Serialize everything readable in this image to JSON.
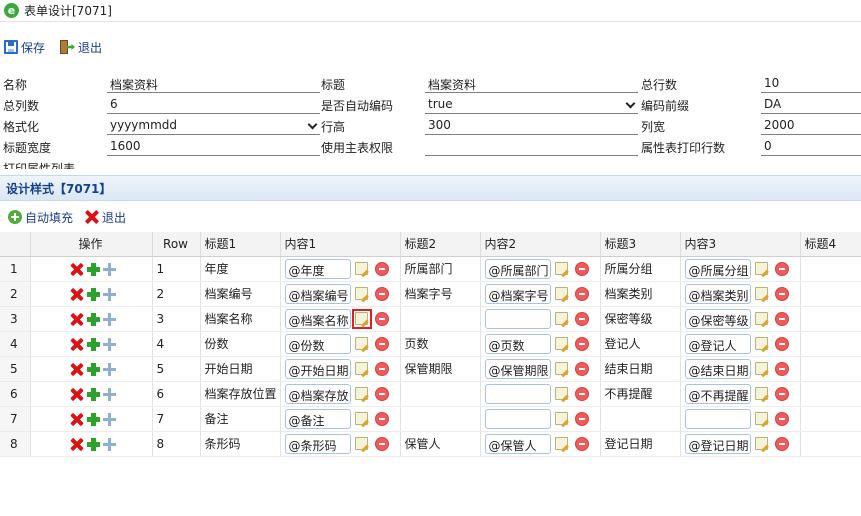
{
  "window": {
    "title": "表单设计[7071]",
    "icon": "app-logo-e"
  },
  "toolbar": {
    "save_label": "保存",
    "exit_label": "退出"
  },
  "form": {
    "rows": [
      [
        {
          "label": "名称",
          "value": "档案资料"
        },
        {
          "label": "标题",
          "value": "档案资料"
        },
        {
          "label": "总行数",
          "value": "10"
        }
      ],
      [
        {
          "label": "总列数",
          "value": "6"
        },
        {
          "label": "是否自动编码",
          "value": "true",
          "select": true
        },
        {
          "label": "编码前缀",
          "value": "DA"
        }
      ],
      [
        {
          "label": "格式化",
          "value": "yyyymmdd",
          "select": true
        },
        {
          "label": "行高",
          "value": "300"
        },
        {
          "label": "列宽",
          "value": "2000"
        }
      ],
      [
        {
          "label": "标题宽度",
          "value": "1600"
        },
        {
          "label": "使用主表权限",
          "value": ""
        },
        {
          "label": "属性表打印行数",
          "value": "0"
        }
      ]
    ],
    "extra_label": "打印属性列表"
  },
  "design": {
    "section_title": "设计样式【7071】",
    "autofill_label": "自动填充",
    "exit_label": "退出",
    "columns": [
      "",
      "操作",
      "Row",
      "标题1",
      "内容1",
      "标题2",
      "内容2",
      "标题3",
      "内容3",
      "标题4"
    ],
    "rows": [
      {
        "n": "1",
        "row": "1",
        "t1": "年度",
        "c1": "@年度",
        "t2": "所属部门",
        "c2": "@所属部门",
        "t3": "所属分组",
        "c3": "@所属分组"
      },
      {
        "n": "2",
        "row": "2",
        "t1": "档案编号",
        "c1": "@档案编号",
        "t2": "档案字号",
        "c2": "@档案字号",
        "t3": "档案类别",
        "c3": "@档案类别"
      },
      {
        "n": "3",
        "row": "3",
        "t1": "档案名称",
        "c1": "@档案名称",
        "t2": "",
        "c2": "",
        "t3": "保密等级",
        "c3": "@保密等级"
      },
      {
        "n": "4",
        "row": "4",
        "t1": "份数",
        "c1": "@份数",
        "t2": "页数",
        "c2": "@页数",
        "t3": "登记人",
        "c3": "@登记人"
      },
      {
        "n": "5",
        "row": "5",
        "t1": "开始日期",
        "c1": "@开始日期",
        "t2": "保管期限",
        "c2": "@保管期限",
        "t3": "结束日期",
        "c3": "@结束日期"
      },
      {
        "n": "6",
        "row": "6",
        "t1": "档案存放位置",
        "c1": "@档案存放",
        "t2": "",
        "c2": "",
        "t3": "不再提醒",
        "c3": "@不再提醒"
      },
      {
        "n": "7",
        "row": "7",
        "t1": "备注",
        "c1": "@备注",
        "t2": "",
        "c2": "",
        "t3": "",
        "c3": ""
      },
      {
        "n": "8",
        "row": "8",
        "t1": "条形码",
        "c1": "@条形码",
        "t2": "保管人",
        "c2": "@保管人",
        "t3": "登记日期",
        "c3": "@登记日期"
      }
    ]
  },
  "colors": {
    "accent": "#15428b",
    "link": "#1a3f8c",
    "selection": "#e02020"
  }
}
